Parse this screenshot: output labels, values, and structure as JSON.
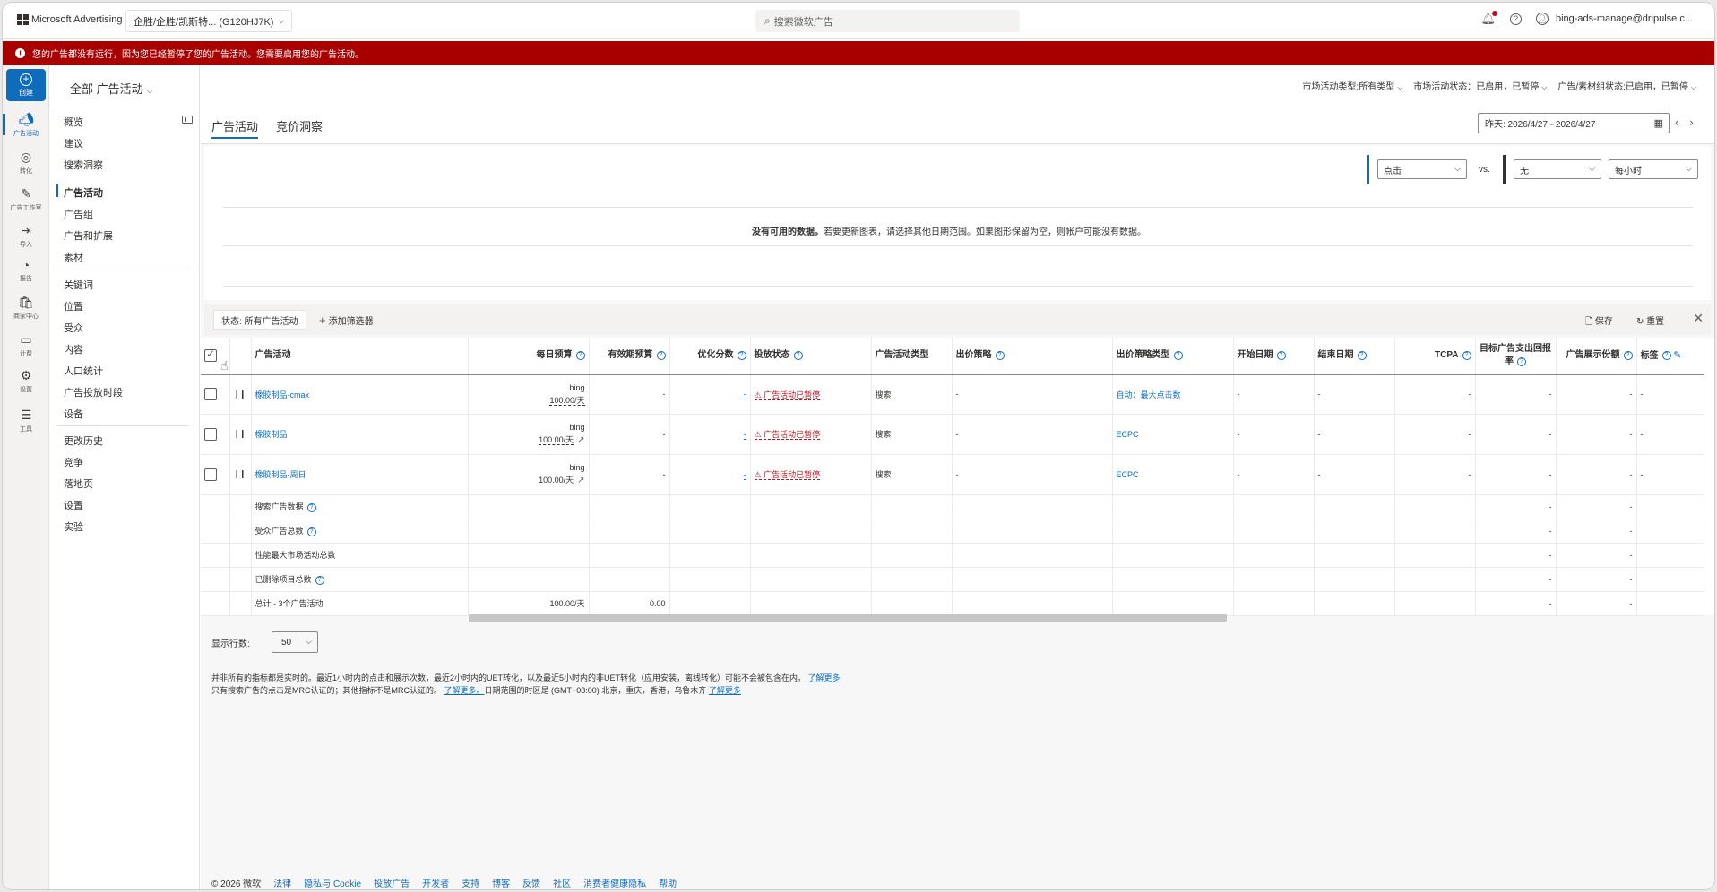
{
  "topbar": {
    "brand": "Microsoft Advertising",
    "account": "企胜/企胜/凯斯特... (G120HJ7K)",
    "search_placeholder": "搜索微软广告",
    "user": "bing-ads-manage@dripulse.c..."
  },
  "banner": {
    "text": "您的广告都没有运行，因为您已经暂停了您的广告活动。您需要启用您的广告活动。"
  },
  "rail": {
    "create": "创建",
    "items": [
      "广告活动",
      "转化",
      "广告工作室",
      "导入",
      "报告",
      "商家中心",
      "计费",
      "设置",
      "工具"
    ]
  },
  "subnav": {
    "scope": "全部 广告活动",
    "items": [
      "概览",
      "建议",
      "搜索洞察",
      "广告活动",
      "广告组",
      "广告和扩展",
      "素材",
      "关键词",
      "位置",
      "受众",
      "内容",
      "人口统计",
      "广告投放时段",
      "设备",
      "更改历史",
      "竞争",
      "落地页",
      "设置",
      "实验"
    ]
  },
  "filters": {
    "type": "市场活动类型:所有类型",
    "status": "市场活动状态：已启用，已暂停",
    "ad_status": "广告/素材组状态:已启用，已暂停"
  },
  "tabs": [
    "广告活动",
    "竞价洞察"
  ],
  "date_range": "昨天: 2026/4/27 - 2026/4/27",
  "chart": {
    "metric1": "点击",
    "vs": "vs.",
    "metric2": "无",
    "interval": "每小时",
    "nodata_bold": "没有可用的数据。",
    "nodata_rest": "若要更新图表，请选择其他日期范围。如果图形保留为空，则帐户可能没有数据。"
  },
  "toolbar": {
    "status_chip": "状态: 所有广告活动",
    "add_filter": "添加筛选器",
    "save": "保存",
    "reset": "重置"
  },
  "table": {
    "headers": {
      "campaign": "广告活动",
      "daily_budget": "每日预算",
      "effective_budget": "有效期预算",
      "opt_score": "优化分数",
      "delivery": "投放状态",
      "campaign_type": "广告活动类型",
      "bid_strategy": "出价策略",
      "bid_strategy_type": "出价策略类型",
      "start_date": "开始日期",
      "end_date": "结束日期",
      "tcpa": "TCPA",
      "target_roas": "目标广告支出回报率",
      "impr_share": "广告展示份额",
      "labels": "标签"
    },
    "rows": [
      {
        "name": "橡胶制品-cmax",
        "budget_src": "bing",
        "budget": "100.00/天",
        "eff": "-",
        "opt": "-",
        "status": "广告活动已暂停",
        "type": "搜索",
        "bid": "-",
        "bid_type": "自动：最大点击数",
        "start": "-",
        "end": "-",
        "tcpa": "-",
        "troas": "-",
        "share": "-",
        "label": "-"
      },
      {
        "name": "橡胶制品",
        "budget_src": "bing",
        "budget": "100.00/天",
        "eff": "-",
        "opt": "-",
        "status": "广告活动已暂停",
        "type": "搜索",
        "bid": "-",
        "bid_type": "ECPC",
        "start": "-",
        "end": "-",
        "tcpa": "-",
        "troas": "-",
        "share": "-",
        "label": "-"
      },
      {
        "name": "橡胶制品-周日",
        "budget_src": "bing",
        "budget": "100.00/天",
        "eff": "-",
        "opt": "-",
        "status": "广告活动已暂停",
        "type": "搜索",
        "bid": "-",
        "bid_type": "ECPC",
        "start": "-",
        "end": "-",
        "tcpa": "-",
        "troas": "-",
        "share": "-",
        "label": "-"
      }
    ],
    "summary": [
      {
        "name": "搜索广告数据",
        "help": true,
        "troas": "-",
        "share": "-"
      },
      {
        "name": "受众广告总数",
        "help": true,
        "troas": "-",
        "share": "-"
      },
      {
        "name": "性能最大市场活动总数",
        "help": false,
        "troas": "-",
        "share": "-"
      },
      {
        "name": "已删除项目总数",
        "help": true,
        "troas": "-",
        "share": "-"
      }
    ],
    "total": {
      "name": "总计 - 3个广告活动",
      "budget": "100.00/天",
      "eff": "0.00",
      "troas": "-",
      "share": "-"
    }
  },
  "rows_per_page": {
    "label": "显示行数:",
    "value": "50"
  },
  "notes": {
    "line1": "并非所有的指标都是实时的。最近1小时内的点击和展示次数，最近2小时内的UET转化，以及最近5小时内的非UET转化（应用安装，离线转化）可能不会被包含在内。",
    "line1_link": "了解更多",
    "line2a": "只有搜索广告的点击是MRC认证的；其他指标不是MRC认证的。",
    "line2_link1": "了解更多。",
    "line2b": "日期范围的时区是 (GMT+08:00) 北京，重庆，香港，乌鲁木齐",
    "line2_link2": "了解更多"
  },
  "footer": {
    "copyright": "© 2026 微软",
    "links": [
      "法律",
      "隐私与 Cookie",
      "投放广告",
      "开发者",
      "支持",
      "博客",
      "反馈",
      "社区",
      "消费者健康隐私",
      "帮助"
    ]
  }
}
